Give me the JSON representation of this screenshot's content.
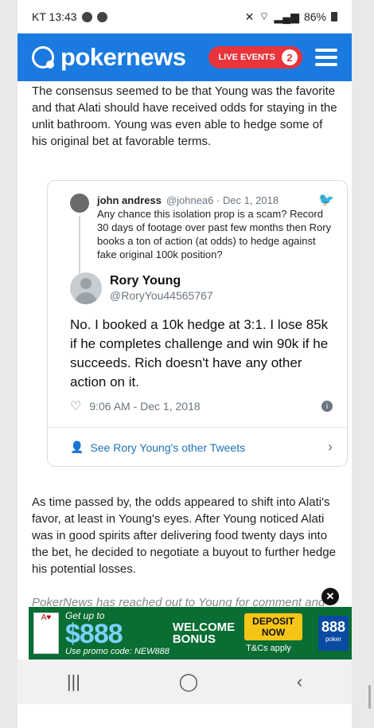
{
  "status_bar": {
    "carrier_time": "KT 13:43",
    "battery": "86%"
  },
  "header": {
    "brand": "pokernews",
    "live_label": "LIVE EVENTS",
    "live_count": "2"
  },
  "article": {
    "p1": "The consensus seemed to be that Young was the favorite and that Alati should have received odds for staying in the unlit bathroom. Young was even able to hedge some of his original bet at favorable terms.",
    "p2": "As time passed by, the odds appeared to shift into Alati's favor, at least in Young's eyes. After Young noticed Alati was in good spirits after delivering food twenty days into the bet, he decided to negotiate a buyout to further hedge his potential losses.",
    "p3": "PokerNews has reached out to Young for comment and"
  },
  "tweet": {
    "quoted": {
      "name": "john andress",
      "handle": "@johnea6 · Dec 1, 2018",
      "text": "Any chance this isolation prop is a scam? Record 30 days of footage over past few months then Rory books a ton of action (at odds) to hedge against fake original 100k position?"
    },
    "author": {
      "name": "Rory Young",
      "handle": "@RoryYou44565767"
    },
    "text": "No. I booked a 10k hedge at 3:1. I lose 85k if he completes challenge and win 90k if he succeeds. Rich doesn't have any other action on it.",
    "time": "9:06 AM - Dec 1, 2018",
    "see_other": "See Rory Young's other Tweets"
  },
  "ad": {
    "get_up_to": "Get up to",
    "amount": "$888",
    "welcome": "WELCOME",
    "bonus": "BONUS",
    "promo": "Use promo code: NEW888",
    "deposit": "DEPOSIT",
    "now": "NOW",
    "tc": "T&Cs apply",
    "logo": "888",
    "logo_sub": "poker"
  },
  "navbar": {
    "recent": "|||",
    "home": "◯",
    "back": "‹"
  }
}
